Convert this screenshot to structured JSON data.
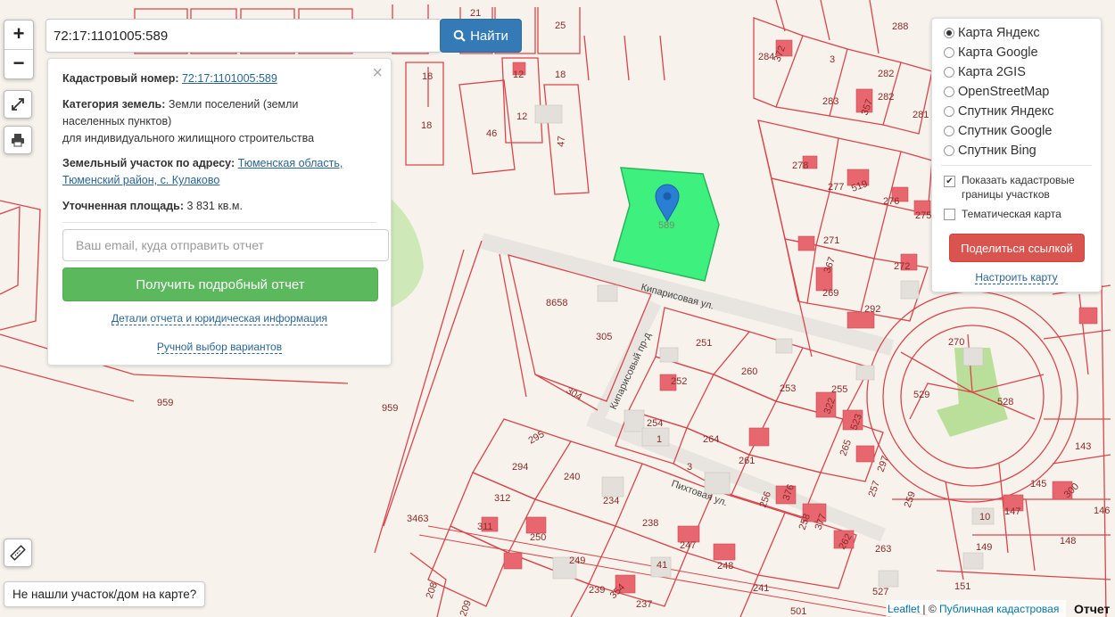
{
  "search": {
    "value": "72:17:1101005:589",
    "button_label": "Найти"
  },
  "zoom": {
    "in": "+",
    "out": "−"
  },
  "info_panel": {
    "cadastral_label": "Кадастровый номер:",
    "cadastral_value": "72:17:1101005:589",
    "category_label": "Категория земель:",
    "category_value_1": "Земли поселений (земли",
    "category_value_2": "населенных пунктов)",
    "category_value_3": "для индивидуального жилищного строительства",
    "address_label": "Земельный участок по адресу:",
    "address_value_1": "Тюменская область,",
    "address_value_2": "Тюменский район, с. Кулаково",
    "area_label": "Уточненная площадь:",
    "area_value": "3 831 кв.м.",
    "email_placeholder": "Ваш email, куда отправить отчет",
    "get_report": "Получить подробный отчет",
    "details_link": "Детали отчета и юридическая информация",
    "manual_link": "Ручной выбор вариантов",
    "close": "×"
  },
  "layers": {
    "options": [
      "Карта Яндекс",
      "Карта Google",
      "Карта 2GIS",
      "OpenStreetMap",
      "Спутник Яндекс",
      "Спутник Google",
      "Спутник Bing"
    ],
    "selected": "Карта Яндекс",
    "show_borders_1": "Показать кадастровые",
    "show_borders_2": "границы участков",
    "thematic": "Тематическая карта",
    "share": "Поделиться ссылкой",
    "tune": "Настроить карту"
  },
  "not_found": "Не нашли участок/дом на карте?",
  "attribution": {
    "leaflet": "Leaflet",
    "sep": "| ©",
    "pkk": "Публичная кадастровая"
  },
  "report_tab": "Отчет",
  "map": {
    "selected_parcel_label": "589",
    "streets": [
      "Кипарисовая ул.",
      "Кипарисовый пр-д",
      "Пихтовая ул."
    ],
    "parcel_labels": [
      "21",
      "25",
      "18",
      "12",
      "18",
      "12",
      "18",
      "46",
      "47",
      "284",
      "372",
      "3",
      "283",
      "282",
      "288",
      "357",
      "281",
      "278",
      "277",
      "519",
      "276",
      "275",
      "271",
      "367",
      "272",
      "269",
      "292",
      "270",
      "8658",
      "305",
      "251",
      "260",
      "252",
      "304",
      "253",
      "255",
      "322",
      "254",
      "1",
      "264",
      "523",
      "529",
      "528",
      "959",
      "959",
      "295",
      "294",
      "240",
      "265",
      "297",
      "261",
      "312",
      "234",
      "3",
      "256",
      "376",
      "257",
      "143",
      "300",
      "145",
      "311",
      "250",
      "3463",
      "238",
      "238",
      "377",
      "147",
      "259",
      "10",
      "146",
      "148",
      "247",
      "249",
      "41",
      "248",
      "262",
      "263",
      "149",
      "239",
      "354",
      "241",
      "527",
      "151",
      "208",
      "209",
      "237",
      "501"
    ],
    "colors": {
      "parcel_stroke": "#d9454c",
      "selected_fill": "#3ef07d",
      "marker": "#2a7fd4",
      "green_area": "#cfe8b8"
    }
  }
}
